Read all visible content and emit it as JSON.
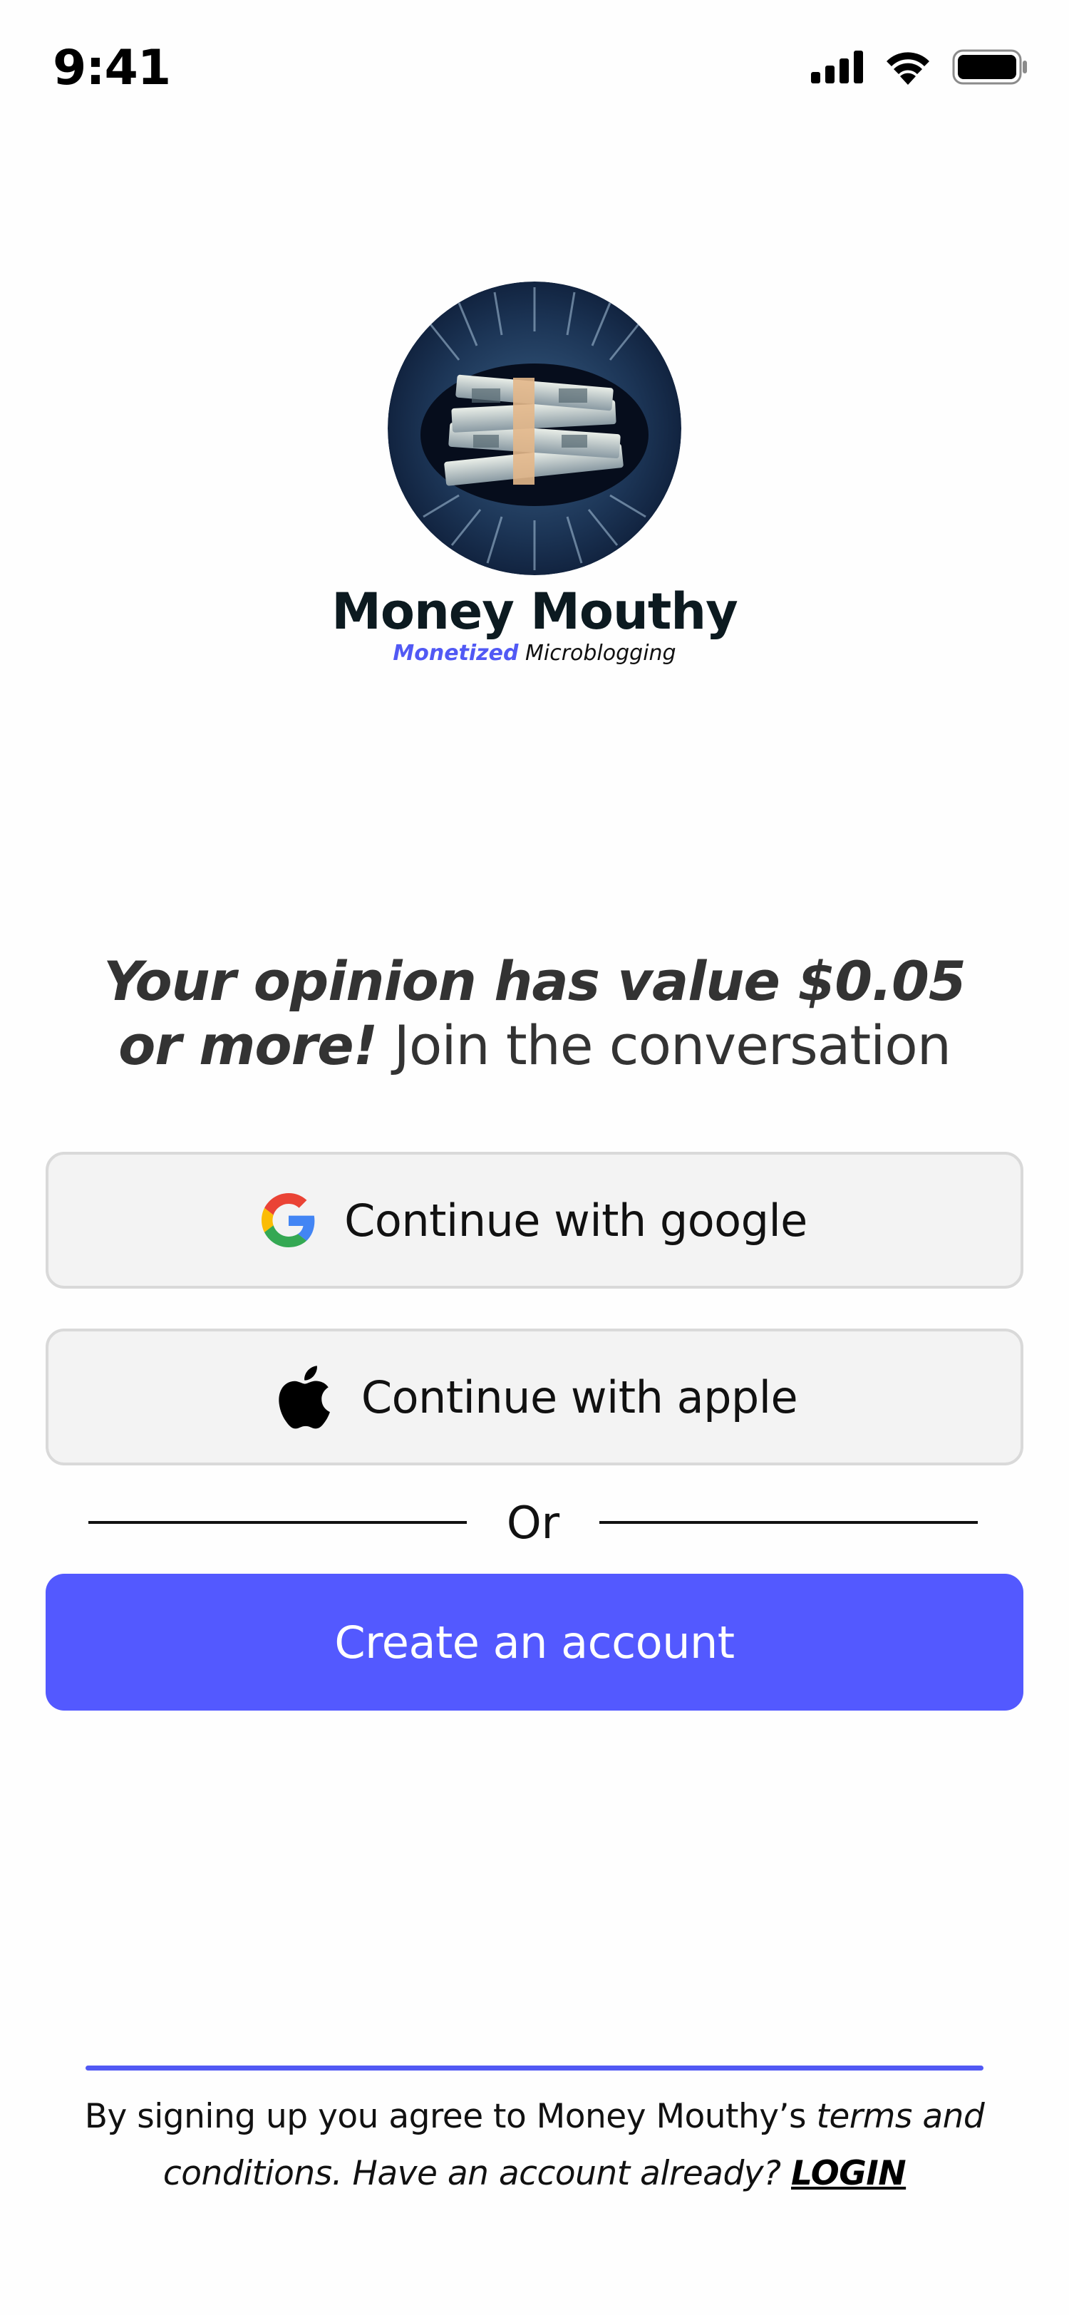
{
  "status_bar": {
    "time": "9:41",
    "icons": [
      "cellular-signal-icon",
      "wifi-icon",
      "battery-icon"
    ]
  },
  "brand": {
    "logo": "money-lips-logo",
    "name": "Money Mouthy",
    "tagline_accent": "Monetized",
    "tagline_rest": " Microblogging",
    "accent_color": "#5159f4"
  },
  "headline": {
    "emphasis": "Your opinion has value $0.05 or more!",
    "rest": " Join the conversation"
  },
  "auth": {
    "google_label": "Continue with google",
    "apple_label": "Continue with apple",
    "or_label": "Or",
    "create_label": "Create an account",
    "primary_color": "#5359ff"
  },
  "footer": {
    "prefix": "By signing up you agree to Money Mouthy’s ",
    "terms": "terms and conditions.",
    "middle": " Have an account already? ",
    "login": "LOGIN"
  }
}
